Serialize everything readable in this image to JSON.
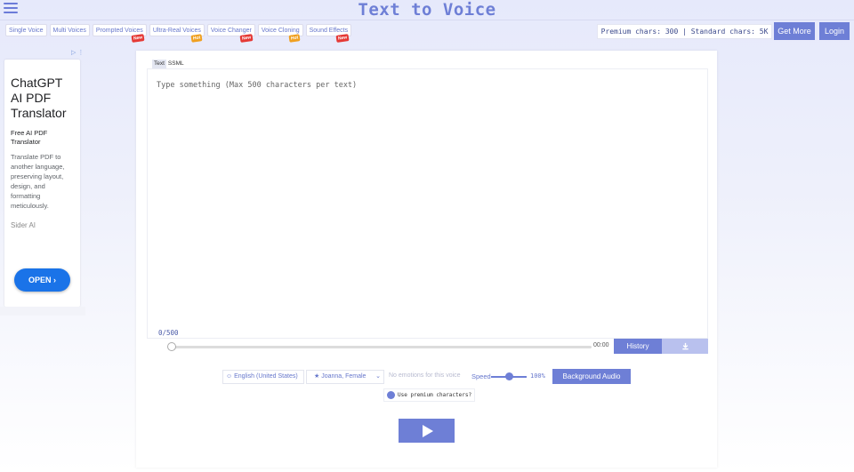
{
  "header": {
    "title": "Text to Voice",
    "tabs": [
      {
        "label": "Single Voice",
        "badge": ""
      },
      {
        "label": "Multi Voices",
        "badge": ""
      },
      {
        "label": "Prompted Voices",
        "badge": "New"
      },
      {
        "label": "Ultra-Real Voices",
        "badge": "Hot"
      },
      {
        "label": "Voice Changer",
        "badge": "New"
      },
      {
        "label": "Voice Cloning",
        "badge": "Hot"
      },
      {
        "label": "Sound Effects",
        "badge": "New"
      }
    ],
    "chars_info": "Premium chars: 300 | Standard chars: 5K",
    "get_more_label": "Get More",
    "login_label": "Login"
  },
  "ad": {
    "title": "ChatGPT AI PDF Translator",
    "subtitle": "Free AI PDF Translator",
    "description": "Translate PDF to another language, preserving layout, design, and formatting meticulously.",
    "brand": "Sider AI",
    "open_label": "OPEN ›",
    "corner": "▷ ⋮"
  },
  "editor": {
    "mode_tabs": [
      "Text",
      "SSML"
    ],
    "active_mode": "Text",
    "placeholder": "Type something (Max 500 characters per text)",
    "counter": "0/500"
  },
  "player": {
    "time": "00:00",
    "history_label": "History",
    "download_icon": "download-icon",
    "progress": 0
  },
  "controls": {
    "language": "☺ English (United States)",
    "voice": "★ Joanna, Female",
    "emotion": "No emotions for this voice",
    "speed_label": "Speed",
    "speed_value": "100%",
    "speed_fraction": 0.5,
    "background_audio_label": "Background Audio",
    "premium_label": "Use premium characters?"
  },
  "colors": {
    "accent": "#6e7fd6",
    "accent_light": "#b9c1ee",
    "badge_new": "#e53935",
    "badge_hot": "#f0a020",
    "ad_button": "#1a73e8"
  }
}
